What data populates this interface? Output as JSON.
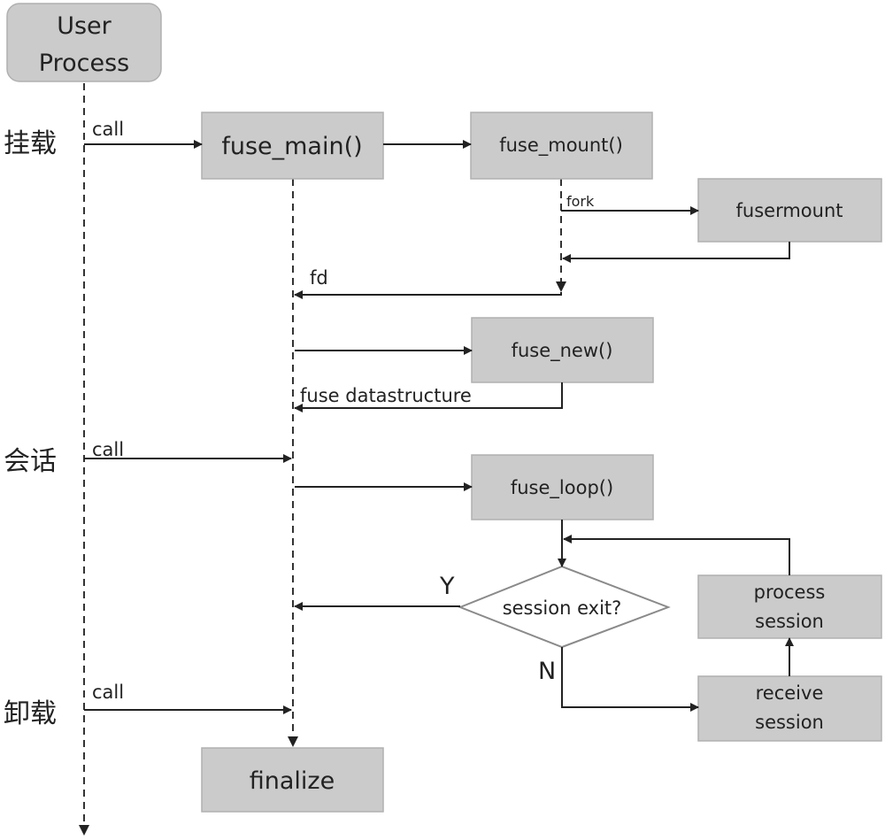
{
  "actors": {
    "user_process_line1": "User",
    "user_process_line2": "Process"
  },
  "phases": {
    "mount": "挂载",
    "session": "会话",
    "unmount": "卸载"
  },
  "boxes": {
    "fuse_main": "fuse_main()",
    "fuse_mount": "fuse_mount()",
    "fusermount": "fusermount",
    "fuse_new": "fuse_new()",
    "fuse_loop": "fuse_loop()",
    "process_session_line1": "process",
    "process_session_line2": "session",
    "receive_session_line1": "receive",
    "receive_session_line2": "session",
    "finalize": "finalize"
  },
  "decision": {
    "label": "session exit?",
    "yes": "Y",
    "no": "N"
  },
  "edge_labels": {
    "call_mount": "call",
    "fork": "fork",
    "fd": "fd",
    "fuse_datastructure": "fuse datastructure",
    "call_session": "call",
    "call_unmount": "call"
  }
}
